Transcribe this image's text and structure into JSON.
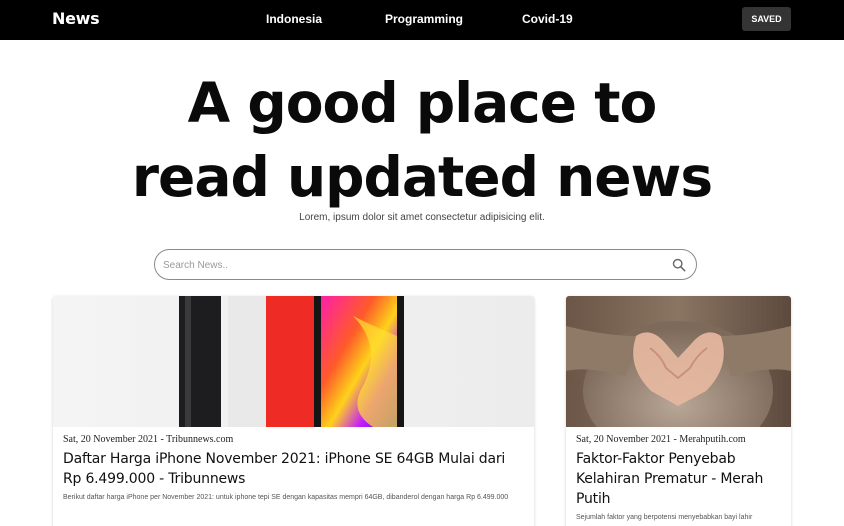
{
  "navbar": {
    "brand": "News",
    "links": [
      "Indonesia",
      "Programming",
      "Covid-19"
    ],
    "saved_label": "SAVED"
  },
  "hero": {
    "title": "A good place to read updated news",
    "subtitle": "Lorem, ipsum dolor sit amet consectetur adipisicing elit."
  },
  "search": {
    "placeholder": "Search News..",
    "value": ""
  },
  "articles": [
    {
      "meta": "Sat, 20 November 2021 - Tribunnews.com",
      "title": "Daftar Harga iPhone November 2021: iPhone SE 64GB Mulai dari Rp 6.499.000 - Tribunnews",
      "description": "Berikut daftar harga iPhone per November 2021: untuk iphone tepi SE dengan kapasitas mempri 64GB, dibanderol dengan harga Rp 6.499.000"
    },
    {
      "meta": "Sat, 20 November 2021 - Merahputih.com",
      "title": "Faktor-Faktor Penyebab Kelahiran Prematur - Merah Putih",
      "description": "Sejumlah faktor yang berpotensi menyebabkan bayi lahir"
    }
  ]
}
